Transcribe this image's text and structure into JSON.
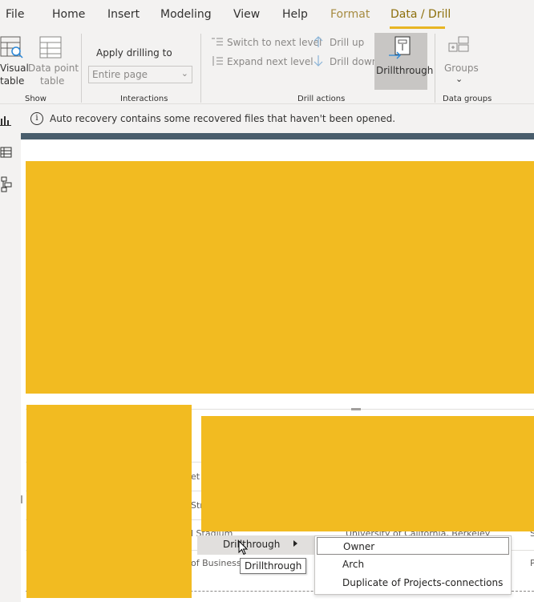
{
  "tabs": [
    {
      "label": "File"
    },
    {
      "label": "Home"
    },
    {
      "label": "Insert"
    },
    {
      "label": "Modeling"
    },
    {
      "label": "View"
    },
    {
      "label": "Help"
    },
    {
      "label": "Format"
    },
    {
      "label": "Data / Drill"
    }
  ],
  "ribbon": {
    "show": {
      "visual_table_line1": "Visual",
      "visual_table_line2": "table",
      "data_point_table_line1": "Data point",
      "data_point_table_line2": "table",
      "label": "Show"
    },
    "interactions": {
      "apply_drilling_to": "Apply drilling to",
      "dropdown_value": "Entire page",
      "label": "Interactions"
    },
    "drill_actions": {
      "switch_to_next_level": "Switch to next level",
      "expand_next_level": "Expand next level",
      "drill_up": "Drill up",
      "drill_down": "Drill down",
      "drillthrough": "Drillthrough",
      "label": "Drill actions"
    },
    "data_groups": {
      "groups": "Groups",
      "label": "Data groups"
    }
  },
  "infobar": {
    "message": "Auto recovery contains some recovered files that haven't been opened."
  },
  "table": {
    "cells": [
      {
        "text": "et C"
      },
      {
        "text": "Stre"
      },
      {
        "text": "l Stadium"
      },
      {
        "text": "University of California, Berkeley"
      },
      {
        "text": "of Business"
      },
      {
        "text": "P"
      },
      {
        "text": "S"
      },
      {
        "text": "e"
      }
    ]
  },
  "context_menu": {
    "item": "Drillthrough",
    "tooltip": "Drillthrough",
    "submenu": [
      {
        "label": "Owner"
      },
      {
        "label": "Arch"
      },
      {
        "label": "Duplicate of Projects-connections"
      }
    ]
  },
  "colors": {
    "accent": "#e8b523",
    "placeholder_yellow": "#f2bb21",
    "header_bar": "#495d6c"
  }
}
